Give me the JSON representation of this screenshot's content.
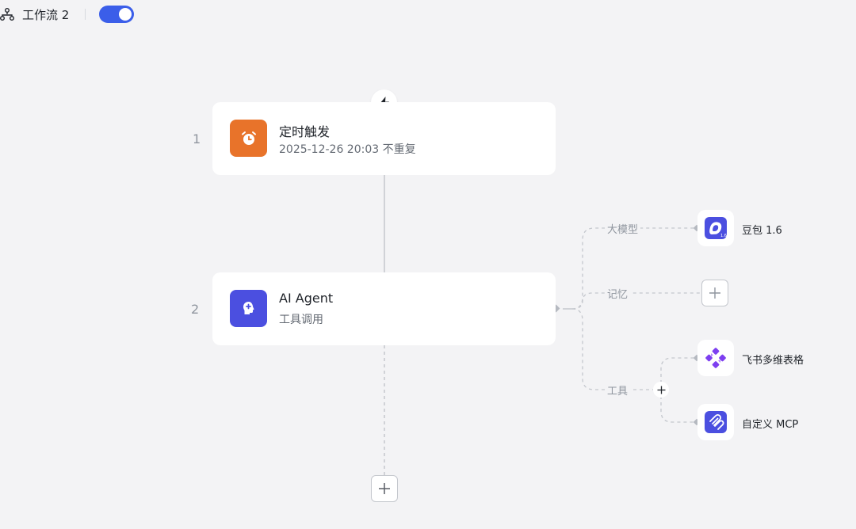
{
  "header": {
    "workflow_name": "工作流 2",
    "enabled": true,
    "accent_color": "#3b5ee9"
  },
  "nodes": [
    {
      "index": "1",
      "title": "定时触发",
      "subtitle": "2025-12-26 20:03 不重复",
      "icon": "alarm-clock-icon",
      "icon_bg": "#e8732a"
    },
    {
      "index": "2",
      "title": "AI Agent",
      "subtitle": "工具调用",
      "icon": "agent-head-icon",
      "icon_bg": "#4b4fe0"
    }
  ],
  "agent_branches": {
    "model": {
      "label": "大模型",
      "resource": "豆包 1.6",
      "icon": "doubao-icon"
    },
    "memory": {
      "label": "记忆"
    },
    "tools": {
      "label": "工具",
      "items": [
        {
          "label": "飞书多维表格",
          "icon": "feishu-bitable-icon"
        },
        {
          "label": "自定义 MCP",
          "icon": "mcp-icon"
        }
      ]
    }
  }
}
